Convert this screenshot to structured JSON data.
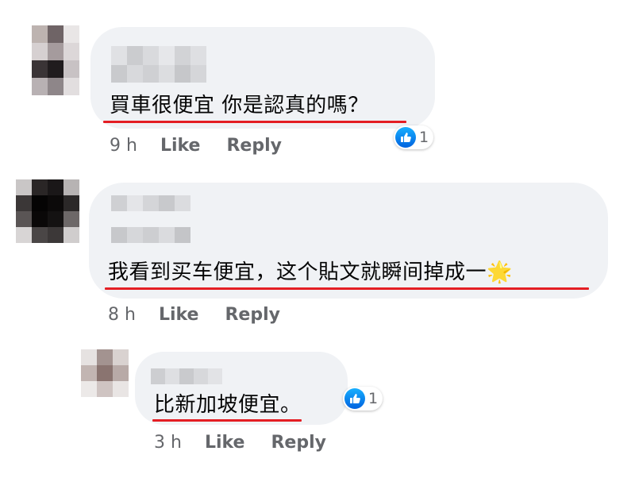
{
  "colors": {
    "bubble": "#f0f2f5",
    "underline": "#e41e24",
    "like_blue": "#1877f2",
    "meta_text": "#65676b"
  },
  "comments": [
    {
      "text": "買車很便宜 你是認真的嗎？",
      "time": "9 h",
      "like_label": "Like",
      "reply_label": "Reply",
      "reaction_icon": "thumbs-up-icon",
      "reaction_count": "1"
    },
    {
      "text": "我看到买车便宜，这个貼文就瞬间掉成一",
      "emoji": "🌟",
      "time": "8 h",
      "like_label": "Like",
      "reply_label": "Reply"
    },
    {
      "text": "比新加坡便宜。",
      "time": "3 h",
      "like_label": "Like",
      "reply_label": "Reply",
      "reaction_icon": "thumbs-up-icon",
      "reaction_count": "1"
    }
  ]
}
